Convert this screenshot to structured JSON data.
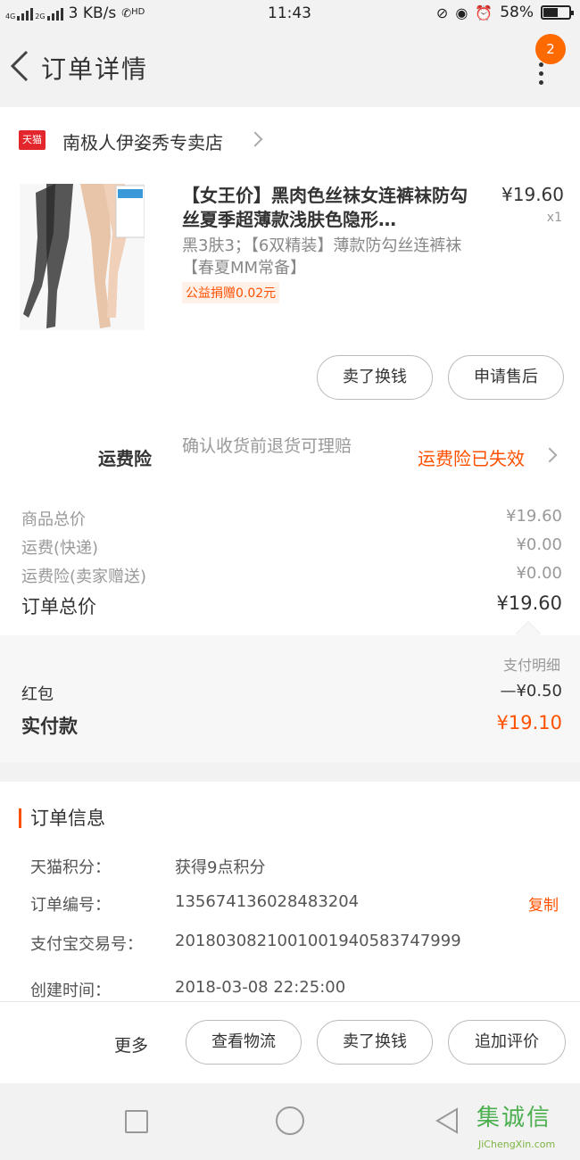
{
  "status_bar": {
    "net_4g": "4G",
    "net_2g": "2G",
    "speed": "3 KB/s",
    "hd": "HD",
    "time": "11:43",
    "battery": "58%",
    "battery_level": 0.58
  },
  "header": {
    "title": "订单详情",
    "badge_count": "2",
    "back_icon": "chevron-left-icon",
    "more_icon": "more-vertical-icon"
  },
  "shop": {
    "platform_tag": "天猫",
    "name": "南极人伊姿秀专卖店"
  },
  "product": {
    "title": "【女王价】黑肉色丝袜女连裤袜防勾丝夏季超薄款浅肤色隐形…",
    "sku": "黑3肤3；【6双精装】薄款防勾丝连裤袜【春夏MM常备】",
    "charity": "公益捐赠0.02元",
    "price": "¥19.60",
    "qty": "x1",
    "buttons": [
      "卖了换钱",
      "申请售后"
    ]
  },
  "insurance": {
    "label": "运费险",
    "desc": "确认收货前退货可理赔",
    "status": "运费险已失效"
  },
  "prices": [
    {
      "label": "商品总价",
      "value": "¥19.60"
    },
    {
      "label": "运费(快递)",
      "value": "¥0.00"
    },
    {
      "label": "运费险(卖家赠送)",
      "value": "¥0.00"
    }
  ],
  "order_total": {
    "label": "订单总价",
    "value": "¥19.60"
  },
  "payment": {
    "detail_label": "支付明细",
    "red_packet_label": "红包",
    "red_packet_value": "—¥0.50",
    "paid_label": "实付款",
    "paid_value": "¥19.10"
  },
  "order_info": {
    "title": "订单信息",
    "rows": [
      {
        "label": "天猫积分：",
        "value": "获得9点积分"
      },
      {
        "label": "订单编号：",
        "value": "135674136028483204"
      },
      {
        "label": "支付宝交易号：",
        "value": "2018030821001001940583747999"
      },
      {
        "label": "创建时间：",
        "value": "2018-03-08 22:25:00"
      }
    ],
    "copy_label": "复制"
  },
  "bottom_bar": {
    "more": "更多",
    "buttons": [
      "查看物流",
      "卖了换钱",
      "追加评价"
    ]
  },
  "watermark": {
    "logo": "集诚信",
    "url": "JiChengXin.com"
  },
  "colors": {
    "accent": "#ff5000",
    "badge": "#ff6a00",
    "tmall": "#e3262c"
  }
}
